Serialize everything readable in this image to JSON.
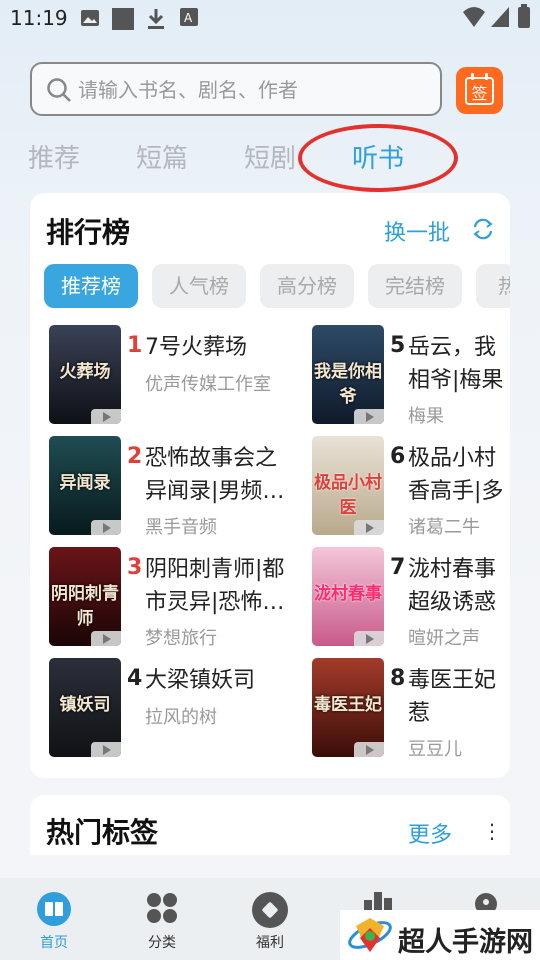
{
  "status_bar": {
    "time": "11:19",
    "icons": [
      "image-icon",
      "square-icon",
      "download-icon",
      "text-a-icon",
      "wifi-icon",
      "signal-icon",
      "battery-icon"
    ]
  },
  "search": {
    "placeholder": "请输入书名、剧名、作者",
    "value": "",
    "sign_label": "签",
    "sign_color": "#ff6a1e"
  },
  "tabs": [
    {
      "label": "推荐",
      "active": false
    },
    {
      "label": "短篇",
      "active": false
    },
    {
      "label": "短剧",
      "active": false
    },
    {
      "label": "听书",
      "active": true
    }
  ],
  "ranking": {
    "title": "排行榜",
    "refresh_label": "换一批",
    "filters": [
      {
        "label": "推荐榜",
        "active": true
      },
      {
        "label": "人气榜",
        "active": false
      },
      {
        "label": "高分榜",
        "active": false
      },
      {
        "label": "完结榜",
        "active": false
      },
      {
        "label": "热",
        "active": false
      }
    ],
    "books": [
      {
        "rank": "1",
        "title": "7号火葬场",
        "author": "优声传媒工作室",
        "cover_text": "火葬场",
        "cover_colors": [
          "#3a4256",
          "#0e1016"
        ]
      },
      {
        "rank": "2",
        "title": "恐怖故事会之异闻录|男频…",
        "author": "黑手音频",
        "cover_text": "异闻录",
        "cover_colors": [
          "#1f4d52",
          "#071a1d"
        ]
      },
      {
        "rank": "3",
        "title": "阴阳刺青师|都市灵异|恐怖…",
        "author": "梦想旅行",
        "cover_text": "阴阳刺青师",
        "cover_colors": [
          "#6a1518",
          "#1a0506"
        ]
      },
      {
        "rank": "4",
        "title": "大梁镇妖司",
        "author": "拉风的树",
        "cover_text": "镇妖司",
        "cover_colors": [
          "#2b2f3a",
          "#111216"
        ]
      },
      {
        "rank": "5",
        "title": "岳云，我相爷|梅果",
        "author": "梅果",
        "cover_text": "我是你相爷",
        "cover_colors": [
          "#2e4a66",
          "#0f1a2a"
        ]
      },
      {
        "rank": "6",
        "title": "极品小村香高手|多",
        "author": "诸葛二牛",
        "cover_text": "极品小村医",
        "cover_colors": [
          "#e8e2d6",
          "#b9a98c"
        ]
      },
      {
        "rank": "7",
        "title": "泷村春事超级诱惑",
        "author": "暄妍之声",
        "cover_text": "泷村春事",
        "cover_colors": [
          "#f3c6d8",
          "#c85a8a"
        ]
      },
      {
        "rank": "8",
        "title": "毒医王妃惹",
        "author": "豆豆儿",
        "cover_text": "毒医王妃",
        "cover_colors": [
          "#a33b2a",
          "#3a0d08"
        ]
      }
    ]
  },
  "tags_section": {
    "title": "热门标签",
    "more_label": "更多"
  },
  "bottom_nav": [
    {
      "label": "首页",
      "icon": "home-book-icon",
      "active": true
    },
    {
      "label": "分类",
      "icon": "category-icon",
      "active": false
    },
    {
      "label": "福利",
      "icon": "welfare-icon",
      "active": false
    },
    {
      "label": "",
      "icon": "ranking-icon",
      "active": false
    },
    {
      "label": "",
      "icon": "profile-icon",
      "active": false
    }
  ],
  "watermark": {
    "text": "超人手游网"
  },
  "colors": {
    "accent": "#2f9fdc",
    "rank_red": "#e0403a",
    "annotation_red": "#e5312e"
  }
}
